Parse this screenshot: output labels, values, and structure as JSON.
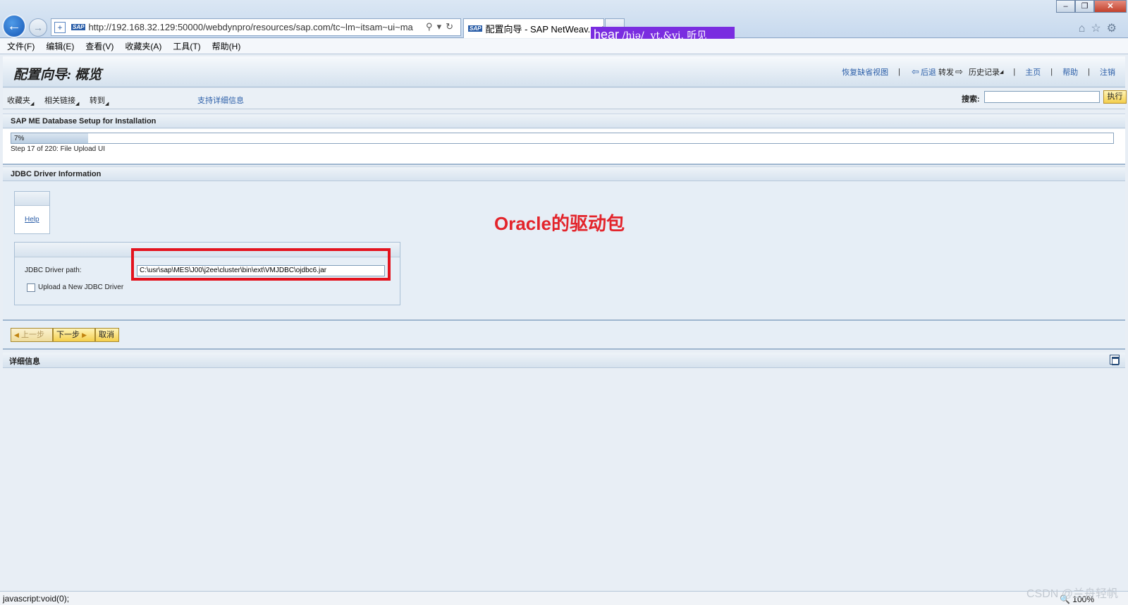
{
  "browser": {
    "address_url": "http://192.168.32.129:50000/webdynpro/resources/sap.com/tc~lm~itsam~ui~ma",
    "tab_title": "配置向导 - SAP NetWeav...",
    "dict_popup": {
      "word": "hear",
      "phonetic": "/hiə/",
      "meaning": "vt.&vi. 听见"
    },
    "menu": [
      "文件(F)",
      "编辑(E)",
      "查看(V)",
      "收藏夹(A)",
      "工具(T)",
      "帮助(H)"
    ],
    "status_text": "javascript:void(0);",
    "zoom": "100%"
  },
  "header": {
    "title": "配置向导: 概览",
    "links": {
      "restore": "恢复缺省视图",
      "back": "后退",
      "forward": "转发",
      "history": "历史记录",
      "home": "主页",
      "help": "帮助",
      "logoff": "注销"
    }
  },
  "toolbar": {
    "favorites": "收藏夹",
    "related_links": "相关链接",
    "goto": "转到",
    "support_details": "支持详细信息",
    "search_label": "搜索:",
    "search_value": "",
    "execute": "执行"
  },
  "setup": {
    "title": "SAP ME Database Setup for Installation",
    "progress_percent": 7,
    "progress_label": "7%",
    "step_text": "Step 17 of 220: File Upload UI"
  },
  "jdbc": {
    "title": "JDBC Driver Information",
    "help": "Help",
    "driver_path_label": "JDBC Driver path:",
    "driver_path_value": "C:\\usr\\sap\\MES\\J00\\j2ee\\cluster\\bin\\ext\\VMJDBC\\ojdbc6.jar",
    "upload_label": "Upload a New JDBC Driver",
    "upload_checked": false
  },
  "annotation": "Oracle的驱动包",
  "nav": {
    "prev": "上一步",
    "next": "下一步",
    "cancel": "取消"
  },
  "details": {
    "title": "详细信息"
  },
  "watermark": "CSDN @兰舟轻帆"
}
